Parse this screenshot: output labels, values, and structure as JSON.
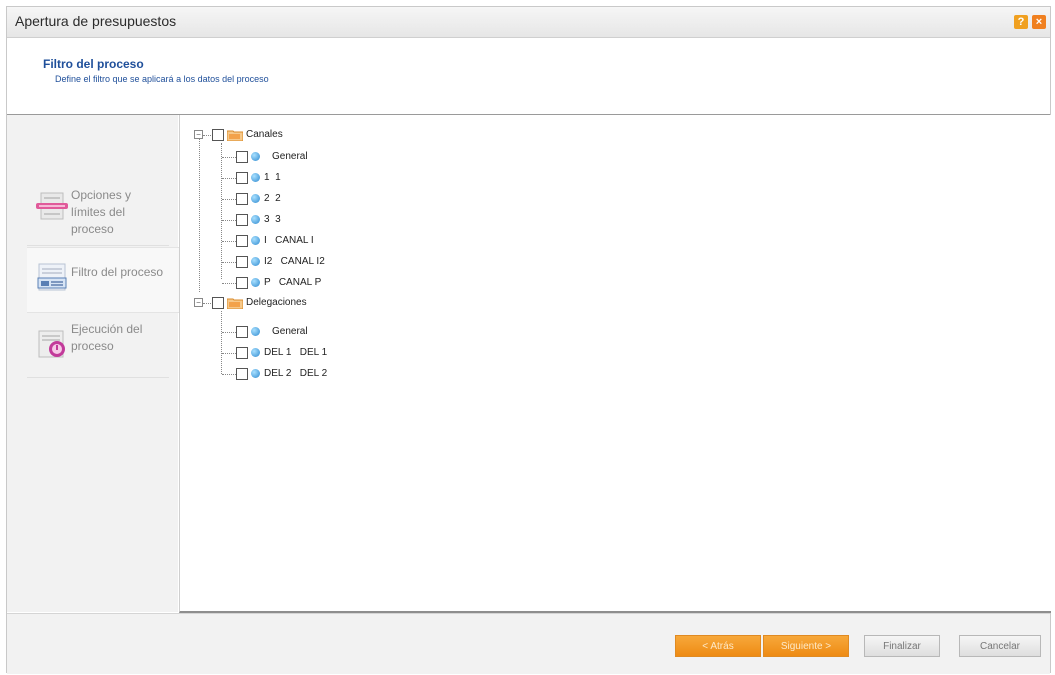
{
  "window": {
    "title": "Apertura de presupuestos",
    "help_glyph": "?",
    "close_glyph": "×"
  },
  "header": {
    "title": "Filtro del proceso",
    "subtitle": "Define el filtro que se aplicará a los datos del proceso"
  },
  "sidebar": {
    "items": [
      {
        "label": "Opciones y límites del proceso",
        "icon": "options-icon",
        "active": false
      },
      {
        "label": "Filtro del proceso",
        "icon": "filter-icon",
        "active": true
      },
      {
        "label": "Ejecución del proceso",
        "icon": "execution-icon",
        "active": false
      }
    ]
  },
  "tree": {
    "groups": [
      {
        "label": "Canales",
        "expander": "−",
        "children": [
          "General",
          "1  1",
          "2  2",
          "3  3",
          "I   CANAL I",
          "I2   CANAL I2",
          "P   CANAL P"
        ]
      },
      {
        "label": "Delegaciones",
        "expander": "−",
        "children": [
          "General",
          "DEL 1   DEL 1",
          "DEL 2   DEL 2"
        ]
      }
    ]
  },
  "footer": {
    "back_label": "< Atrás",
    "next_label": "Siguiente >",
    "finish_label": "Finalizar",
    "cancel_label": "Cancelar"
  },
  "colors": {
    "accent_orange": "#ee8b14",
    "header_blue": "#1f4f9a",
    "panel_grey": "#f2f2f2"
  }
}
